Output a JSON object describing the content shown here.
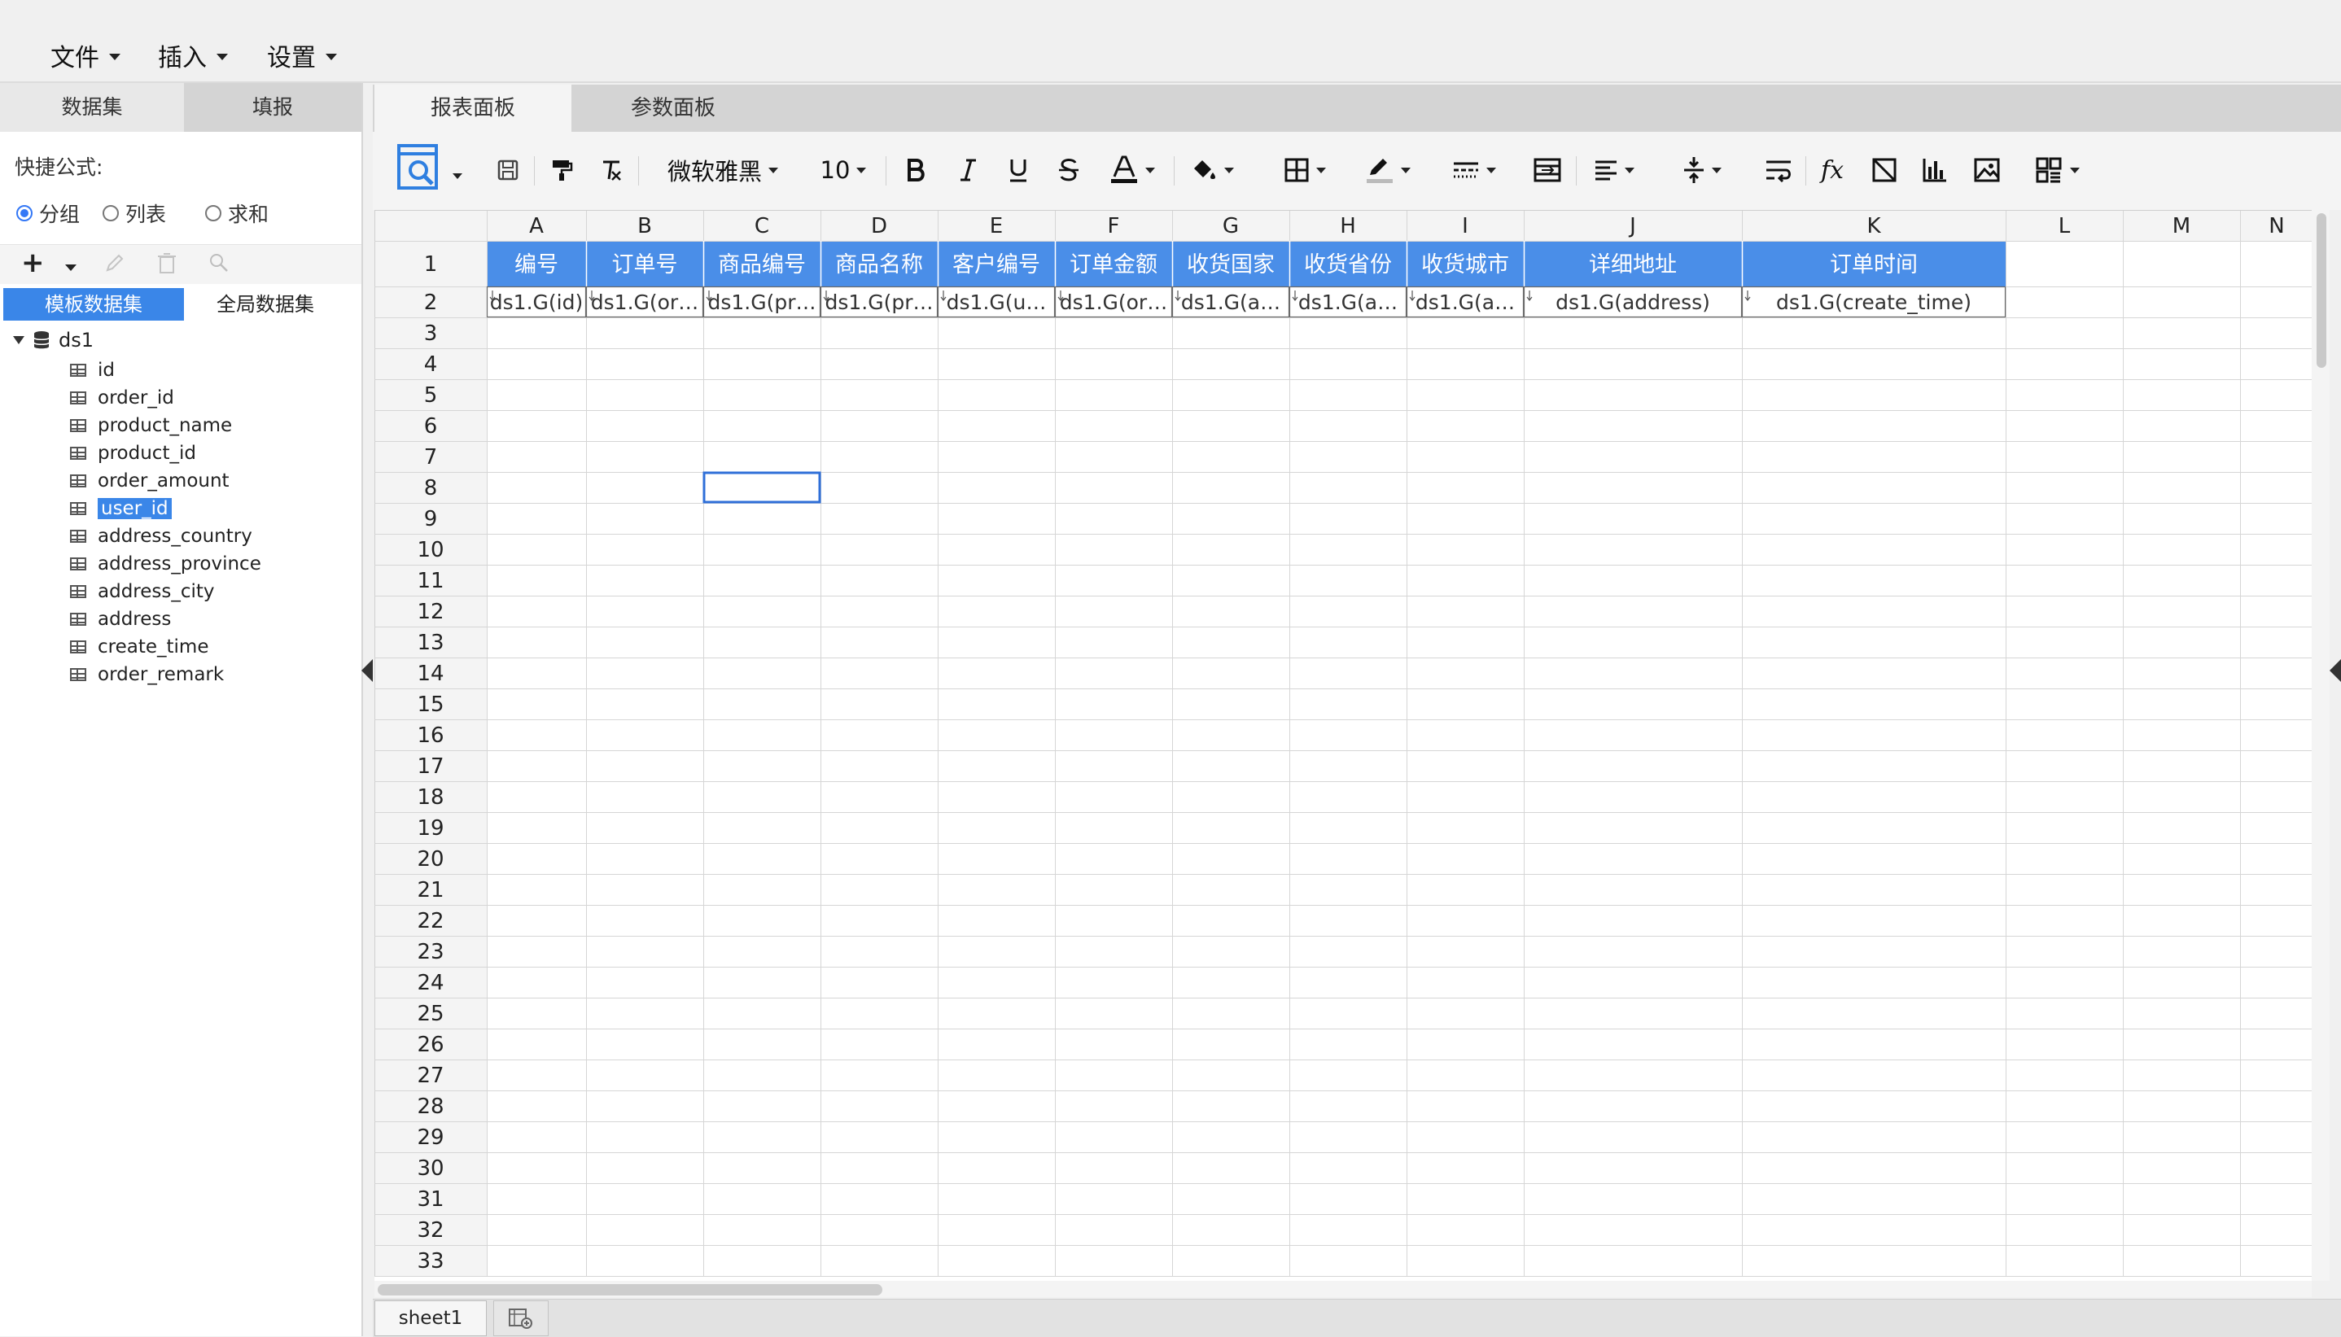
{
  "menu": [
    {
      "label": "文件"
    },
    {
      "label": "插入"
    },
    {
      "label": "设置"
    }
  ],
  "left_panel": {
    "tabs": [
      "数据集",
      "填报"
    ],
    "quick_formula_label": "快捷公式:",
    "radios": [
      {
        "label": "分组",
        "checked": true
      },
      {
        "label": "列表",
        "checked": false
      },
      {
        "label": "求和",
        "checked": false
      }
    ],
    "toolbar_icons": [
      "add-icon",
      "edit-icon",
      "delete-icon",
      "search-icon"
    ],
    "dataset_tabs": [
      "模板数据集",
      "全局数据集"
    ],
    "tree": {
      "root": "ds1",
      "fields": [
        "id",
        "order_id",
        "product_name",
        "product_id",
        "order_amount",
        "user_id",
        "address_country",
        "address_province",
        "address_city",
        "address",
        "create_time",
        "order_remark"
      ],
      "selected": "user_id"
    }
  },
  "right_panel": {
    "tabs": [
      "报表面板",
      "参数面板"
    ],
    "toolbar": {
      "font_family": "微软雅黑",
      "font_size": "10"
    }
  },
  "sheet": {
    "columns": [
      "A",
      "B",
      "C",
      "D",
      "E",
      "F",
      "G",
      "H",
      "I",
      "J",
      "K",
      "L",
      "M",
      "N"
    ],
    "row_count": 33,
    "header_row": [
      "编号",
      "订单号",
      "商品编号",
      "商品名称",
      "客户编号",
      "订单金额",
      "收货国家",
      "收货省份",
      "收货城市",
      "详细地址",
      "订单时间"
    ],
    "binding_row": [
      "ds1.G(id)",
      "ds1.G(or…",
      "ds1.G(pr…",
      "ds1.G(pr…",
      "ds1.G(u…",
      "ds1.G(or…",
      "ds1.G(a…",
      "ds1.G(a…",
      "ds1.G(a…",
      "ds1.G(address)",
      "ds1.G(create_time)"
    ],
    "header_fill": "#4a8ee8",
    "selected_cell": "C8",
    "sheet_tab": "sheet1"
  }
}
